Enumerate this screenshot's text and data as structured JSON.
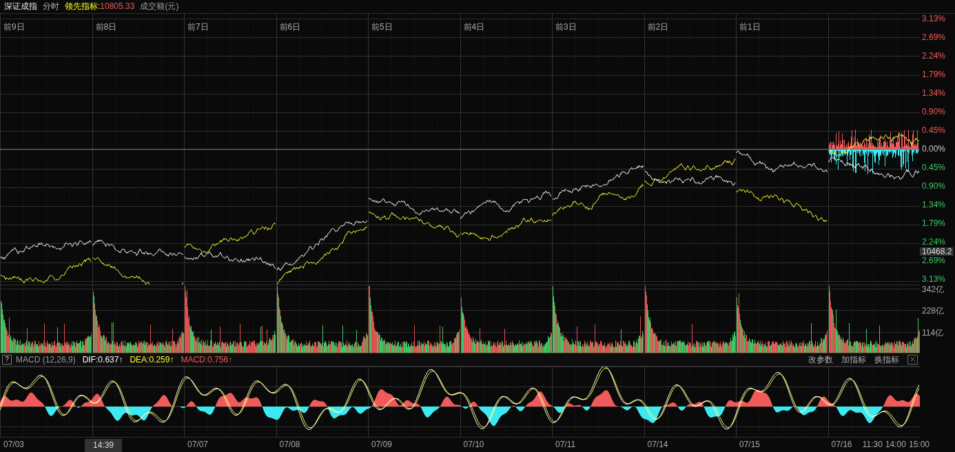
{
  "header": {
    "index_name": "深证成指",
    "mode": "分时",
    "lead_label": "领先指标:",
    "lead_value": "10805.33",
    "volume_label": "成交额(元)"
  },
  "main_chart": {
    "day_labels": [
      "前9日",
      "前8日",
      "前7日",
      "前6日",
      "前5日",
      "前4日",
      "前3日",
      "前2日",
      "前1日"
    ],
    "y_labels": [
      {
        "text": "3.13%",
        "kind": "up"
      },
      {
        "text": "2.69%",
        "kind": "up"
      },
      {
        "text": "2.24%",
        "kind": "up"
      },
      {
        "text": "1.79%",
        "kind": "up"
      },
      {
        "text": "1.34%",
        "kind": "up"
      },
      {
        "text": "0.90%",
        "kind": "up"
      },
      {
        "text": "0.45%",
        "kind": "up"
      },
      {
        "text": "0.00%",
        "kind": "flat"
      },
      {
        "text": "0.45%",
        "kind": "down"
      },
      {
        "text": "0.90%",
        "kind": "down"
      },
      {
        "text": "1.34%",
        "kind": "down"
      },
      {
        "text": "1.79%",
        "kind": "down"
      },
      {
        "text": "2.24%",
        "kind": "down"
      },
      {
        "text": "2.69%",
        "kind": "down"
      },
      {
        "text": "3.13%",
        "kind": "down"
      }
    ],
    "price_tag": "10468.2"
  },
  "volume_chart": {
    "y_labels": [
      "342亿",
      "228亿",
      "114亿"
    ]
  },
  "macd": {
    "help": "?",
    "name": "MACD (12,26,9)",
    "dif": "DIF:0.637↑",
    "dea": "DEA:0.259↑",
    "value": "MACD:0.756↑",
    "buttons": [
      "改参数",
      "加指标",
      "换指标"
    ]
  },
  "time_axis": {
    "columns": [
      {
        "date": "07/03"
      },
      {},
      {
        "date": "07/07"
      },
      {
        "date": "07/08"
      },
      {
        "date": "07/09"
      },
      {
        "date": "07/10"
      },
      {
        "date": "07/11"
      },
      {
        "date": "07/14"
      },
      {
        "date": "07/15"
      },
      {
        "date": "07/16",
        "times": [
          "11:30",
          "14:00",
          "15:00"
        ]
      }
    ],
    "cursor_label": "14:39"
  }
}
